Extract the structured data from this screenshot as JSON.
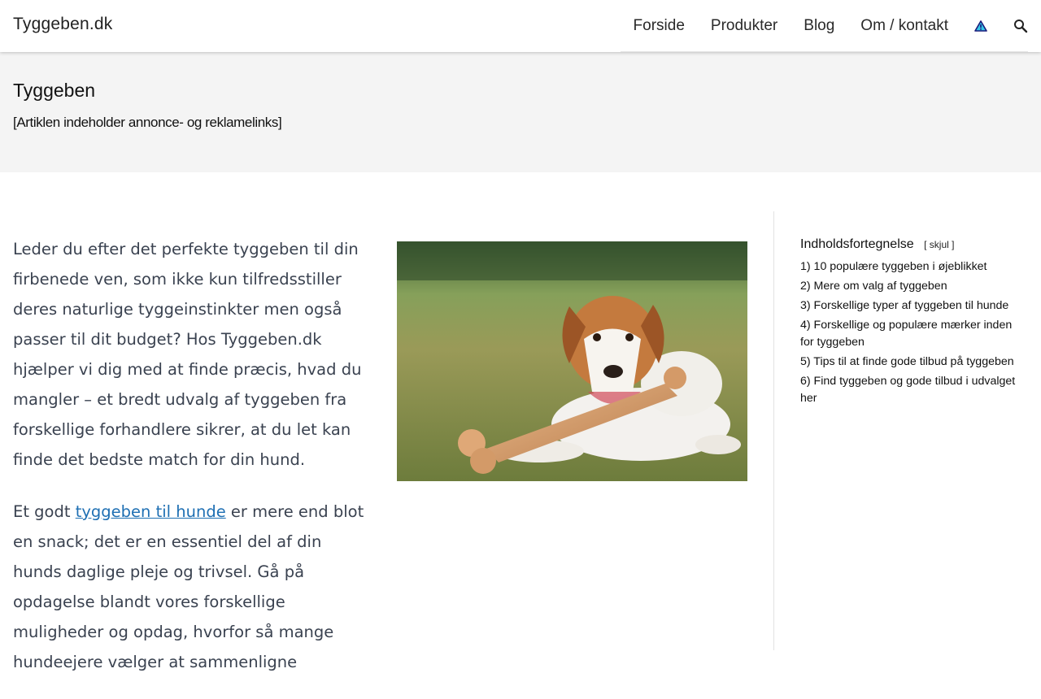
{
  "header": {
    "site_title": "Tyggeben.dk",
    "nav": [
      "Forside",
      "Produkter",
      "Blog",
      "Om / kontakt"
    ],
    "icons": [
      "warning-icon",
      "search-icon"
    ]
  },
  "hero": {
    "title": "Tyggeben",
    "note": "[Artiklen indeholder annonce- og reklamelinks]"
  },
  "content": {
    "p1": "Leder du efter det perfekte tyggeben til din firbenede ven, som ikke kun tilfredsstiller deres naturlige tyggeinstinkter men også passer til dit budget? Hos Tyggeben.dk hjælper vi dig med at finde præcis, hvad du mangler – et bredt udvalg af tyggeben fra forskellige forhandlere sikrer, at du let kan finde det bedste match for din hund.",
    "p2_before": "Et godt",
    "p2_link": "tyggeben til hunde",
    "p2_after": "er mere end blot en snack; det er en essentiel del af din hunds daglige pleje og trivsel. Gå på opdagelse blandt vores forskellige muligheder og opdag, hvorfor så mange hundeejere vælger at sammenligne"
  },
  "toc": {
    "title": "Indholdsfortegnelse",
    "toggle": "[ skjul ]",
    "items": [
      "1) 10 populære tyggeben i øjeblikket",
      "2) Mere om valg af tyggeben",
      "3) Forskellige typer af tyggeben til hunde",
      "4) Forskellige og populære mærker inden for tyggeben",
      "5) Tips til at finde gode tilbud på tyggeben",
      "6) Find tyggeben og gode tilbud i udvalget her"
    ]
  },
  "colors": {
    "link": "#1e6fb3",
    "hero_bg": "#f4f4f4",
    "text": "#3a4250"
  }
}
